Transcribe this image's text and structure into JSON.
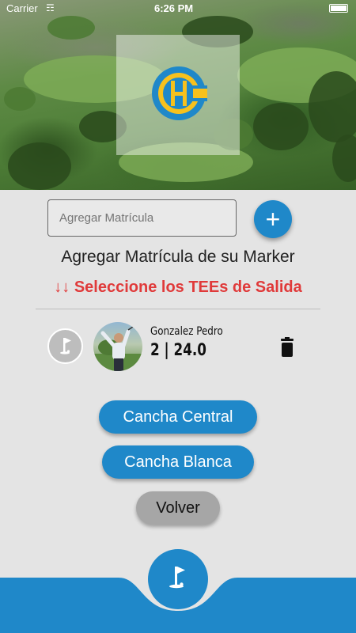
{
  "status_bar": {
    "carrier": "Carrier",
    "time": "6:26 PM"
  },
  "header": {
    "logo_letter": "H",
    "logo_colors": {
      "ring": "#1f88c9",
      "inner": "#f7c11d"
    }
  },
  "form": {
    "matricula_placeholder": "Agregar Matrícula",
    "add_icon": "plus-icon",
    "title": "Agregar Matrícula de su Marker",
    "tees_hint": "↓↓ Seleccione los TEEs de Salida"
  },
  "player": {
    "name": "Gonzalez Pedro",
    "stats": "2 | 24.0",
    "tee_icon": "golf-flag-icon",
    "delete_icon": "trash-icon"
  },
  "buttons": {
    "central": "Cancha Central",
    "blanca": "Cancha Blanca",
    "volver": "Volver"
  },
  "bottom_nav": {
    "fab_icon": "golf-flag-icon"
  },
  "colors": {
    "primary": "#1f88c9",
    "warning_text": "#e03a3a",
    "background": "#e4e4e4",
    "secondary_button": "#a6a6a6"
  }
}
